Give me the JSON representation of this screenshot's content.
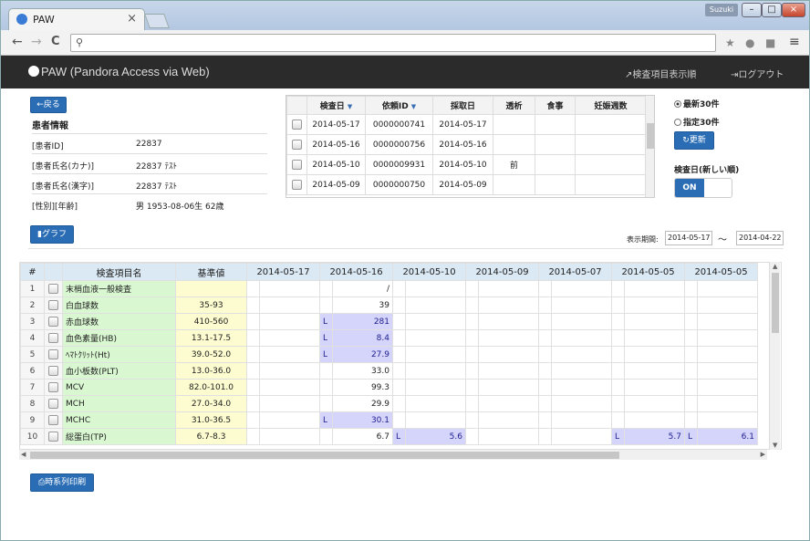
{
  "browser": {
    "tab_title": "PAW",
    "tab_close": "×",
    "user_badge": "Suzuki",
    "win_min": "–",
    "win_max": "□",
    "win_close": "×",
    "back": "←",
    "forward": "→",
    "reload": "C",
    "menu": "≡"
  },
  "app": {
    "title": "PAW (Pandora Access via Web)",
    "nav_order": "検査項目表示順",
    "nav_logout": "ログアウト"
  },
  "left": {
    "back_button": "←戻る",
    "patient_title": "患者情報",
    "fields": [
      {
        "key": "[患者ID]",
        "value": "22837"
      },
      {
        "key": "[患者氏名(カナ)]",
        "value": "22837 ﾃｽﾄ"
      },
      {
        "key": "[患者氏名(漢字)]",
        "value": "22837 ﾃｽﾄ"
      },
      {
        "key": "[性別][年齢]",
        "value": "男 1953-08-06生 62歳"
      }
    ],
    "graph_button": "グラフ",
    "print_button": "時系列印刷"
  },
  "visits": {
    "headers": [
      "検査日",
      "依頼ID",
      "採取日",
      "透析",
      "食事",
      "妊娠週数"
    ],
    "rows": [
      {
        "date": "2014-05-17",
        "id": "0000000741",
        "collected": "2014-05-17",
        "dialysis": "",
        "meal": "",
        "weeks": ""
      },
      {
        "date": "2014-05-16",
        "id": "0000000756",
        "collected": "2014-05-16",
        "dialysis": "",
        "meal": "",
        "weeks": ""
      },
      {
        "date": "2014-05-10",
        "id": "0000009931",
        "collected": "2014-05-10",
        "dialysis": "前",
        "meal": "",
        "weeks": ""
      },
      {
        "date": "2014-05-09",
        "id": "0000000750",
        "collected": "2014-05-09",
        "dialysis": "",
        "meal": "",
        "weeks": ""
      }
    ]
  },
  "controls": {
    "radio_latest": "最新30件",
    "radio_specified": "指定30件",
    "refresh_button": "更新",
    "sort_label": "検査日(新しい順)",
    "toggle_on": "ON",
    "selected_radio": "最新30件"
  },
  "period": {
    "label": "表示期間:",
    "from": "2014-05-17",
    "tilde": "～",
    "to": "2014-04-22"
  },
  "grid": {
    "col_hash": "#",
    "col_name": "検査項目名",
    "col_ref": "基準値",
    "dates": [
      "2014-05-17",
      "2014-05-16",
      "2014-05-10",
      "2014-05-09",
      "2014-05-07",
      "2014-05-05",
      "2014-05-05"
    ],
    "rows": [
      {
        "n": "1",
        "name": "末梢血液一般検査",
        "ref": "",
        "v": [
          "",
          "/",
          "",
          "",
          "",
          "",
          ""
        ],
        "f": [
          "",
          "",
          "",
          "",
          "",
          "",
          ""
        ]
      },
      {
        "n": "2",
        "name": "白血球数",
        "ref": "35-93",
        "v": [
          "",
          "39",
          "",
          "",
          "",
          "",
          ""
        ],
        "f": [
          "",
          "",
          "",
          "",
          "",
          "",
          ""
        ]
      },
      {
        "n": "3",
        "name": "赤血球数",
        "ref": "410-560",
        "v": [
          "",
          "281",
          "",
          "",
          "",
          "",
          ""
        ],
        "f": [
          "",
          "L",
          "",
          "",
          "",
          "",
          ""
        ]
      },
      {
        "n": "4",
        "name": "血色素量(HB)",
        "ref": "13.1-17.5",
        "v": [
          "",
          "8.4",
          "",
          "",
          "",
          "",
          ""
        ],
        "f": [
          "",
          "L",
          "",
          "",
          "",
          "",
          ""
        ]
      },
      {
        "n": "5",
        "name": "ﾍﾏﾄｸﾘｯﾄ(Ht)",
        "ref": "39.0-52.0",
        "v": [
          "",
          "27.9",
          "",
          "",
          "",
          "",
          ""
        ],
        "f": [
          "",
          "L",
          "",
          "",
          "",
          "",
          ""
        ]
      },
      {
        "n": "6",
        "name": "血小板数(PLT)",
        "ref": "13.0-36.0",
        "v": [
          "",
          "33.0",
          "",
          "",
          "",
          "",
          ""
        ],
        "f": [
          "",
          "",
          "",
          "",
          "",
          "",
          ""
        ]
      },
      {
        "n": "7",
        "name": "MCV",
        "ref": "82.0-101.0",
        "v": [
          "",
          "99.3",
          "",
          "",
          "",
          "",
          ""
        ],
        "f": [
          "",
          "",
          "",
          "",
          "",
          "",
          ""
        ]
      },
      {
        "n": "8",
        "name": "MCH",
        "ref": "27.0-34.0",
        "v": [
          "",
          "29.9",
          "",
          "",
          "",
          "",
          ""
        ],
        "f": [
          "",
          "",
          "",
          "",
          "",
          "",
          ""
        ]
      },
      {
        "n": "9",
        "name": "MCHC",
        "ref": "31.0-36.5",
        "v": [
          "",
          "30.1",
          "",
          "",
          "",
          "",
          ""
        ],
        "f": [
          "",
          "L",
          "",
          "",
          "",
          "",
          ""
        ]
      },
      {
        "n": "10",
        "name": "総蛋白(TP)",
        "ref": "6.7-8.3",
        "v": [
          "",
          "6.7",
          "5.6",
          "",
          "",
          "5.7",
          "6.1"
        ],
        "f": [
          "",
          "",
          "L",
          "",
          "",
          "L",
          "L"
        ]
      }
    ]
  }
}
